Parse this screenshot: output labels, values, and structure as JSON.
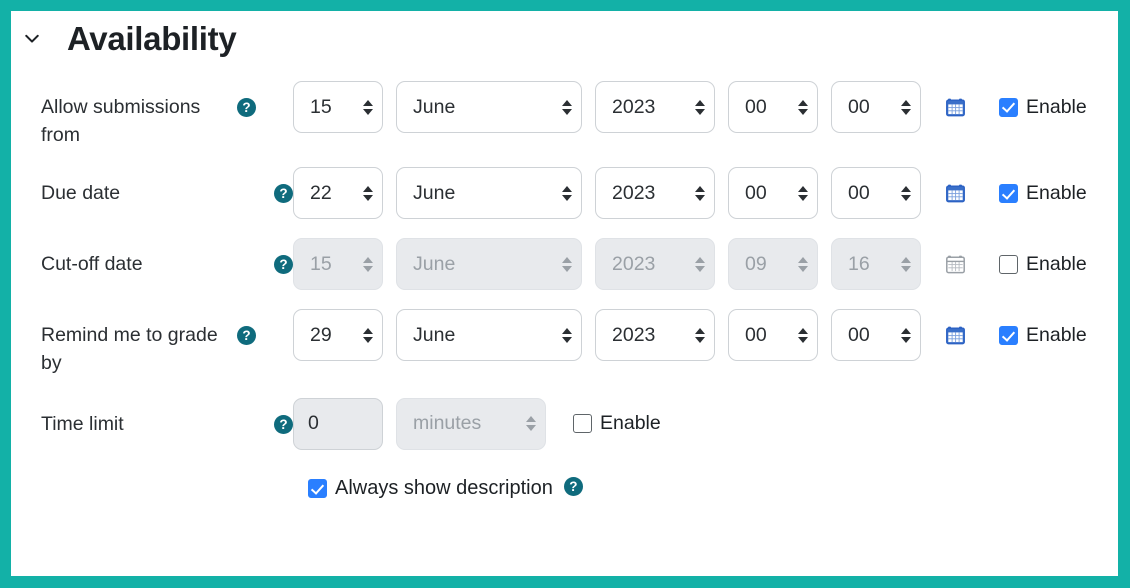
{
  "section": {
    "title": "Availability",
    "collapse_icon": "chevron-down-icon",
    "expanded": true
  },
  "colors": {
    "frame_border": "#13b1a7",
    "help_icon_bg": "#0f6b7d",
    "checkbox_checked": "#2a7fff",
    "calendar_icon": "#2c62c4",
    "calendar_icon_disabled": "#9aa0a6",
    "field_border": "#ced2d6",
    "field_disabled_bg": "#e8eaed",
    "text": "#2b2f33",
    "text_disabled": "#9aa0a6"
  },
  "common": {
    "enable_label": "Enable",
    "help_glyph": "?",
    "calendar_icon_name": "calendar-icon"
  },
  "rows": [
    {
      "id": "allow-submissions-from",
      "label": "Allow submissions from",
      "disabled": false,
      "day": "15",
      "month": "June",
      "year": "2023",
      "hour": "00",
      "minute": "00",
      "enable_label": "Enable",
      "enabled_checked": true
    },
    {
      "id": "due-date",
      "label": "Due date",
      "disabled": false,
      "day": "22",
      "month": "June",
      "year": "2023",
      "hour": "00",
      "minute": "00",
      "enable_label": "Enable",
      "enabled_checked": true
    },
    {
      "id": "cut-off-date",
      "label": "Cut-off date",
      "disabled": true,
      "day": "15",
      "month": "June",
      "year": "2023",
      "hour": "09",
      "minute": "16",
      "enable_label": "Enable",
      "enabled_checked": false
    },
    {
      "id": "remind-me-to-grade-by",
      "label": "Remind me to grade by",
      "disabled": false,
      "day": "29",
      "month": "June",
      "year": "2023",
      "hour": "00",
      "minute": "00",
      "enable_label": "Enable",
      "enabled_checked": true
    }
  ],
  "time_limit": {
    "label": "Time limit",
    "value": "0",
    "units": "minutes",
    "units_disabled": true,
    "enable_label": "Enable",
    "enabled_checked": false
  },
  "always_show_description": {
    "label": "Always show description",
    "checked": true
  }
}
